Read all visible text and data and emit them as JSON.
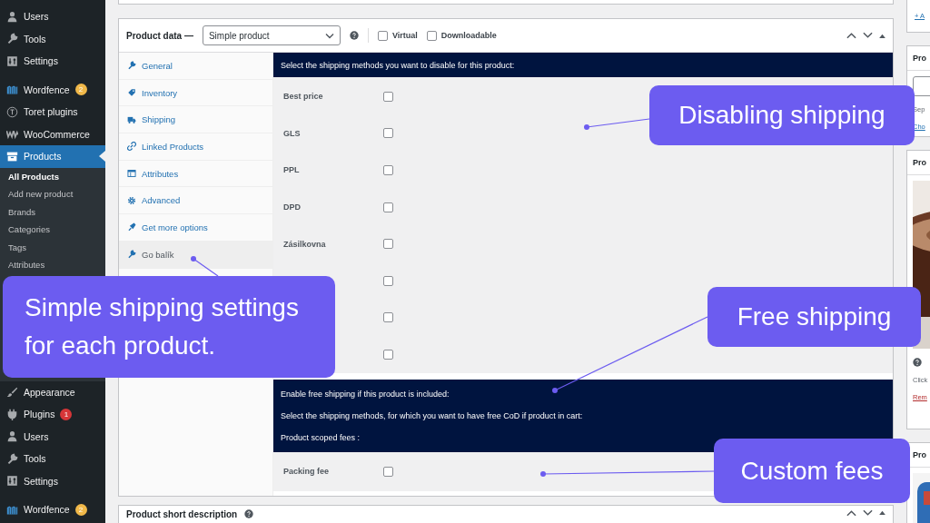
{
  "sidebar": {
    "groups": [
      {
        "items": [
          {
            "label": "Users",
            "kind": "users",
            "selected": false
          },
          {
            "label": "Tools",
            "kind": "tools",
            "selected": false
          },
          {
            "label": "Settings",
            "kind": "settings",
            "selected": false
          }
        ]
      },
      {
        "items": [
          {
            "label": "Wordfence",
            "kind": "wordfence",
            "selected": false,
            "badge": {
              "text": "2",
              "color": "#f0b849"
            }
          },
          {
            "label": "Toret plugins",
            "kind": "toret",
            "selected": false
          },
          {
            "label": "WooCommerce",
            "kind": "woo",
            "selected": false
          },
          {
            "label": "Products",
            "kind": "products",
            "selected": true,
            "children": [
              {
                "label": "All Products",
                "selected": true
              },
              {
                "label": "Add new product",
                "selected": false
              },
              {
                "label": "Brands",
                "selected": false
              },
              {
                "label": "Categories",
                "selected": false
              },
              {
                "label": "Tags",
                "selected": false
              },
              {
                "label": "Attributes",
                "selected": false
              }
            ]
          },
          {
            "label": "Appearance",
            "kind": "appearance",
            "selected": false
          },
          {
            "label": "Plugins",
            "kind": "plugins",
            "selected": false,
            "badge": {
              "text": "1",
              "color": "#d63638"
            }
          },
          {
            "label": "Users",
            "kind": "users",
            "selected": false
          },
          {
            "label": "Tools",
            "kind": "tools",
            "selected": false
          },
          {
            "label": "Settings",
            "kind": "settings",
            "selected": false
          }
        ]
      },
      {
        "items": [
          {
            "label": "Wordfence",
            "kind": "wordfence",
            "selected": false,
            "badge": {
              "text": "2",
              "color": "#f0b849"
            }
          }
        ]
      }
    ]
  },
  "product_data": {
    "title": "Product data —",
    "product_type": "Simple product",
    "options": [
      {
        "label": "Virtual",
        "checked": false
      },
      {
        "label": "Downloadable",
        "checked": false
      }
    ],
    "tabs": [
      {
        "label": "General",
        "kind": "general",
        "selected": false
      },
      {
        "label": "Inventory",
        "kind": "inventory",
        "selected": false
      },
      {
        "label": "Shipping",
        "kind": "shipping",
        "selected": false
      },
      {
        "label": "Linked Products",
        "kind": "linked",
        "selected": false
      },
      {
        "label": "Attributes",
        "kind": "attributes",
        "selected": false
      },
      {
        "label": "Advanced",
        "kind": "advanced",
        "selected": false
      },
      {
        "label": "Get more options",
        "kind": "more",
        "selected": false
      },
      {
        "label": "Go balík",
        "kind": "general",
        "selected": true
      }
    ],
    "disable_heading": "Select the shipping methods you want to disable for this product:",
    "methods": [
      {
        "label": "Best price",
        "checked": false
      },
      {
        "label": "GLS",
        "checked": false
      },
      {
        "label": "PPL",
        "checked": false
      },
      {
        "label": "DPD",
        "checked": false
      },
      {
        "label": "Zásilkovna",
        "checked": false
      },
      {
        "checked": false
      },
      {
        "checked": false
      },
      {
        "checked": false
      }
    ],
    "notes": [
      "Enable free shipping if this product is included:",
      "Select the shipping methods, for which you want to have free CoD if product in cart:",
      "Product scoped fees :"
    ],
    "fees": [
      {
        "label": "Packing fee",
        "checked": false
      }
    ]
  },
  "short_description": {
    "title": "Product short description"
  },
  "right_column": {
    "link_top": "+ A",
    "card_1": {
      "title": "Pro",
      "hint": "Sep",
      "link": "Cho"
    },
    "card_2": {
      "title": "Pro",
      "text": "Click",
      "link": "Rem"
    },
    "card_3": {
      "title": "Pro"
    }
  },
  "callouts": [
    {
      "text": "Disabling shipping"
    },
    {
      "text": "Simple shipping settings for each product."
    },
    {
      "text": "Free shipping"
    },
    {
      "text": "Custom fees"
    }
  ]
}
